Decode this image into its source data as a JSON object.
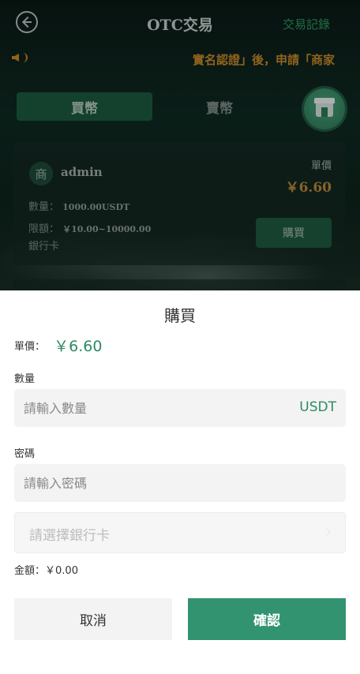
{
  "header": {
    "title": "OTC交易",
    "records_link": "交易記錄"
  },
  "notice": {
    "text": "實名認證」後，申請「商家"
  },
  "tabs": {
    "buy": "買幣",
    "sell": "賣幣"
  },
  "order_card": {
    "avatar_char": "商",
    "seller": "admin",
    "unit_price_label": "單價",
    "unit_price": "￥6.60",
    "quantity_label": "數量：",
    "quantity_value": "1000.00USDT",
    "limit_label": "限額：",
    "limit_value": "￥10.00~10000.00",
    "payment_method": "銀行卡",
    "buy_button": "購買"
  },
  "sheet": {
    "title": "購買",
    "unit_price_label": "單價：",
    "unit_price_value": "￥6.60",
    "quantity_label": "數量",
    "quantity_placeholder": "請輸入數量",
    "quantity_unit": "USDT",
    "password_label": "密碼",
    "password_placeholder": "請輸入密碼",
    "bank_select_placeholder": "請選擇銀行卡",
    "amount_label": "金額：",
    "amount_value": "￥0.00",
    "cancel_button": "取消",
    "confirm_button": "確認"
  },
  "colors": {
    "accent": "#329371",
    "price_green": "#2e8b63",
    "notice_orange": "#c9892a"
  }
}
